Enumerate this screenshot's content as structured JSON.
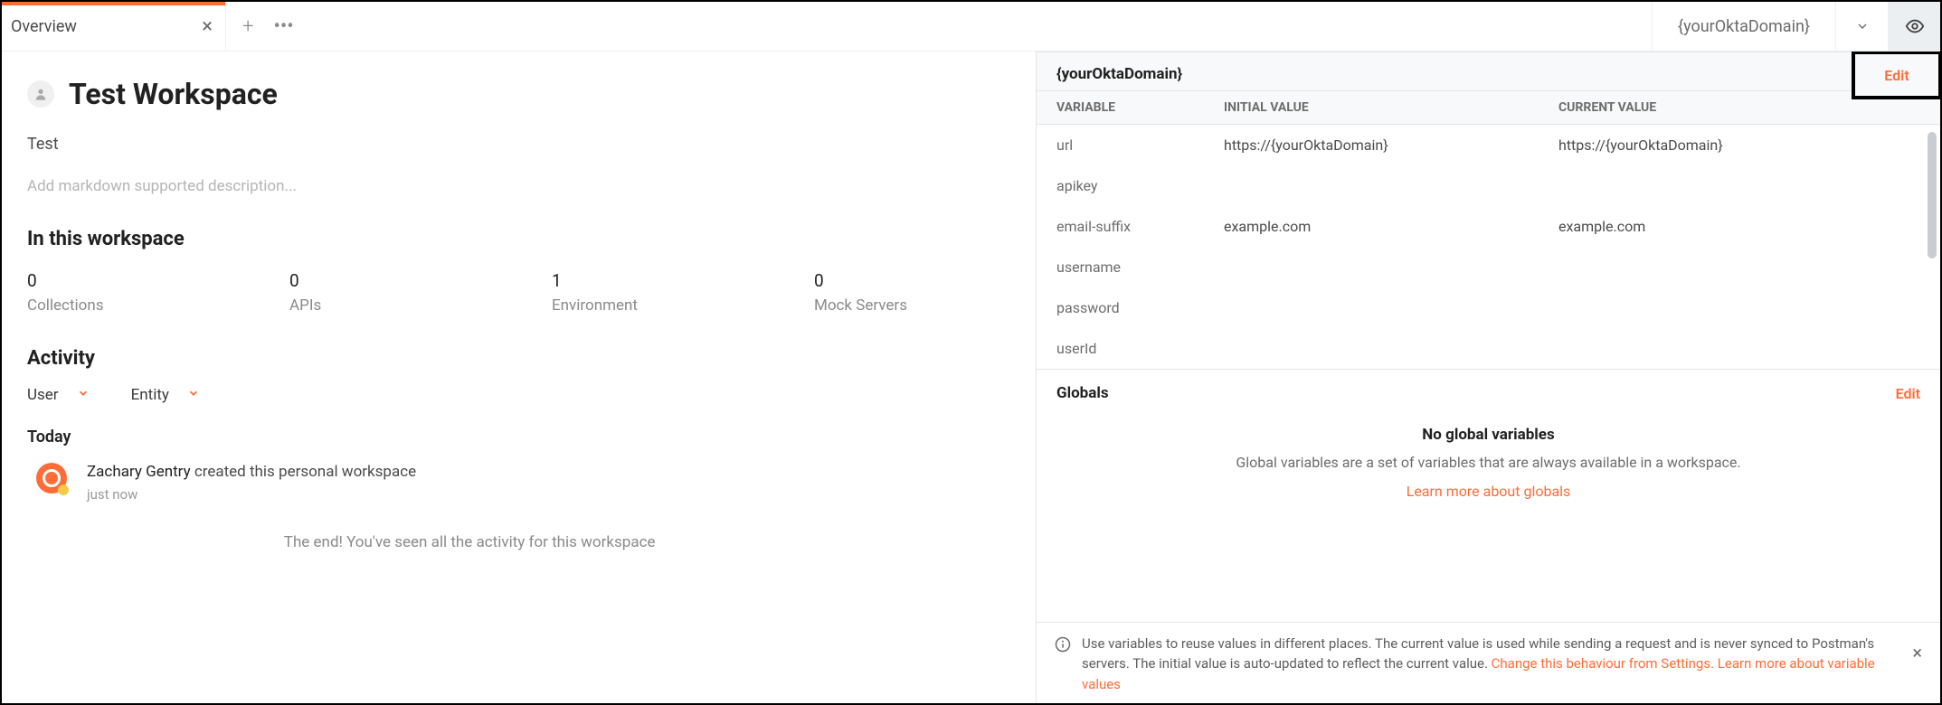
{
  "tab": {
    "label": "Overview"
  },
  "env_selector": {
    "label": "{yourOktaDomain}"
  },
  "workspace": {
    "title": "Test Workspace",
    "subtitle": "Test",
    "description_placeholder": "Add markdown supported description...",
    "section_heading": "In this workspace",
    "stats": [
      {
        "value": "0",
        "label": "Collections"
      },
      {
        "value": "0",
        "label": "APIs"
      },
      {
        "value": "1",
        "label": "Environment"
      },
      {
        "value": "0",
        "label": "Mock Servers"
      }
    ],
    "activity_heading": "Activity",
    "filters": {
      "user": "User",
      "entity": "Entity"
    },
    "today_label": "Today",
    "activity_item": {
      "user": "Zachary Gentry",
      "action": " created this personal workspace",
      "time": "just now"
    },
    "end_message": "The end! You've seen all the activity for this workspace"
  },
  "env_panel": {
    "name": "{yourOktaDomain}",
    "edit": "Edit",
    "headers": {
      "variable": "VARIABLE",
      "initial": "INITIAL VALUE",
      "current": "CURRENT VALUE"
    },
    "rows": [
      {
        "name": "url",
        "initial": "https://{yourOktaDomain}",
        "current": "https://{yourOktaDomain}"
      },
      {
        "name": "apikey",
        "initial": "",
        "current": ""
      },
      {
        "name": "email-suffix",
        "initial": "example.com",
        "current": "example.com"
      },
      {
        "name": "username",
        "initial": "",
        "current": ""
      },
      {
        "name": "password",
        "initial": "",
        "current": ""
      },
      {
        "name": "userId",
        "initial": "",
        "current": ""
      }
    ]
  },
  "globals": {
    "title": "Globals",
    "edit": "Edit",
    "empty_title": "No global variables",
    "empty_text": "Global variables are a set of variables that are always available in a workspace.",
    "learn_link": "Learn more about globals"
  },
  "footer": {
    "text_a": "Use variables to reuse values in different places. The current value is used while sending a request and is never synced to Postman's servers. The initial value is auto-updated to reflect the current value. ",
    "link_a": "Change this behaviour from Settings.",
    "text_b": " ",
    "link_b": "Learn more about variable values"
  }
}
